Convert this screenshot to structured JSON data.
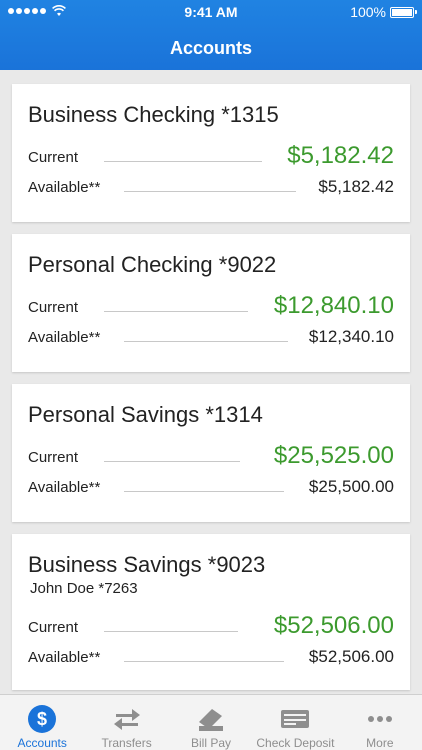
{
  "status_bar": {
    "time": "9:41 AM",
    "battery": "100%"
  },
  "header": {
    "title": "Accounts"
  },
  "accounts": [
    {
      "name": "Business Checking *1315",
      "owner": "",
      "current_label": "Current",
      "current": "$5,182.42",
      "available_label": "Available**",
      "available": "$5,182.42"
    },
    {
      "name": "Personal Checking *9022",
      "owner": "",
      "current_label": "Current",
      "current": "$12,840.10",
      "available_label": "Available**",
      "available": "$12,340.10"
    },
    {
      "name": "Personal Savings *1314",
      "owner": "",
      "current_label": "Current",
      "current": "$25,525.00",
      "available_label": "Available**",
      "available": "$25,500.00"
    },
    {
      "name": "Business Savings *9023",
      "owner": "John Doe *7263",
      "current_label": "Current",
      "current": "$52,506.00",
      "available_label": "Available**",
      "available": "$52,506.00"
    }
  ],
  "tabs": [
    {
      "label": "Accounts",
      "icon": "dollar-icon",
      "active": true
    },
    {
      "label": "Transfers",
      "icon": "transfer-arrows-icon",
      "active": false
    },
    {
      "label": "Bill Pay",
      "icon": "bill-pay-icon",
      "active": false
    },
    {
      "label": "Check Deposit",
      "icon": "check-deposit-icon",
      "active": false
    },
    {
      "label": "More",
      "icon": "more-dots-icon",
      "active": false
    }
  ],
  "colors": {
    "header_blue": "#1a73d9",
    "amount_green": "#3c9a2e",
    "inactive_gray": "#8e8e8e"
  }
}
